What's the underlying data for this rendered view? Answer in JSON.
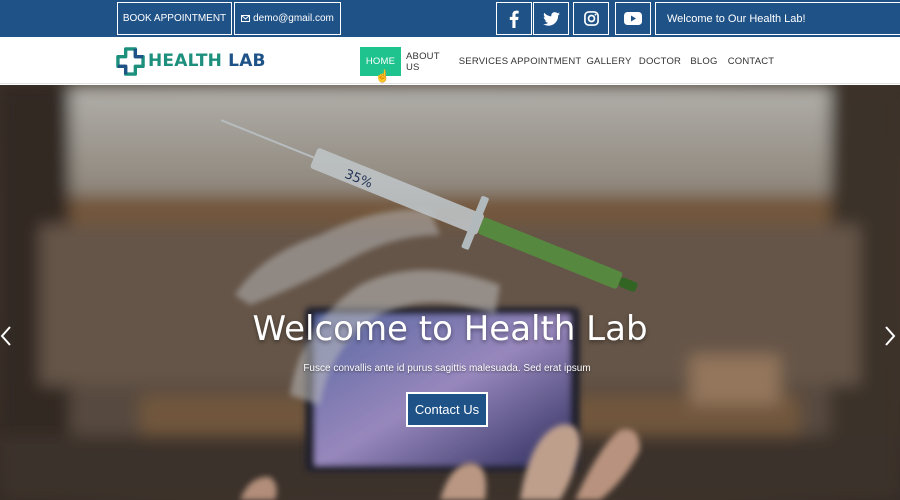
{
  "topbar": {
    "book_label": "BOOK APPOINTMENT",
    "email": "demo@gmail.com",
    "social": [
      "facebook-icon",
      "twitter-icon",
      "instagram-icon",
      "youtube-icon"
    ],
    "welcome": "Welcome to Our Health Lab!"
  },
  "logo": {
    "word1": "HEALTH",
    "word2": "LAB"
  },
  "nav": {
    "items": [
      "HOME",
      "ABOUT US",
      "SERVICES",
      "APPOINTMENT",
      "GALLERY",
      "DOCTOR",
      "BLOG",
      "CONTACT"
    ],
    "active": "HOME"
  },
  "hero": {
    "title": "Welcome to Health Lab",
    "subtitle": "Fusce convallis ante id purus sagittis malesuada. Sed erat ipsum",
    "button": "Contact Us",
    "syringe_label": "35%"
  },
  "colors": {
    "topbar": "#1f5287",
    "accent": "#1fc38e",
    "logo_green": "#1c8f7d"
  }
}
